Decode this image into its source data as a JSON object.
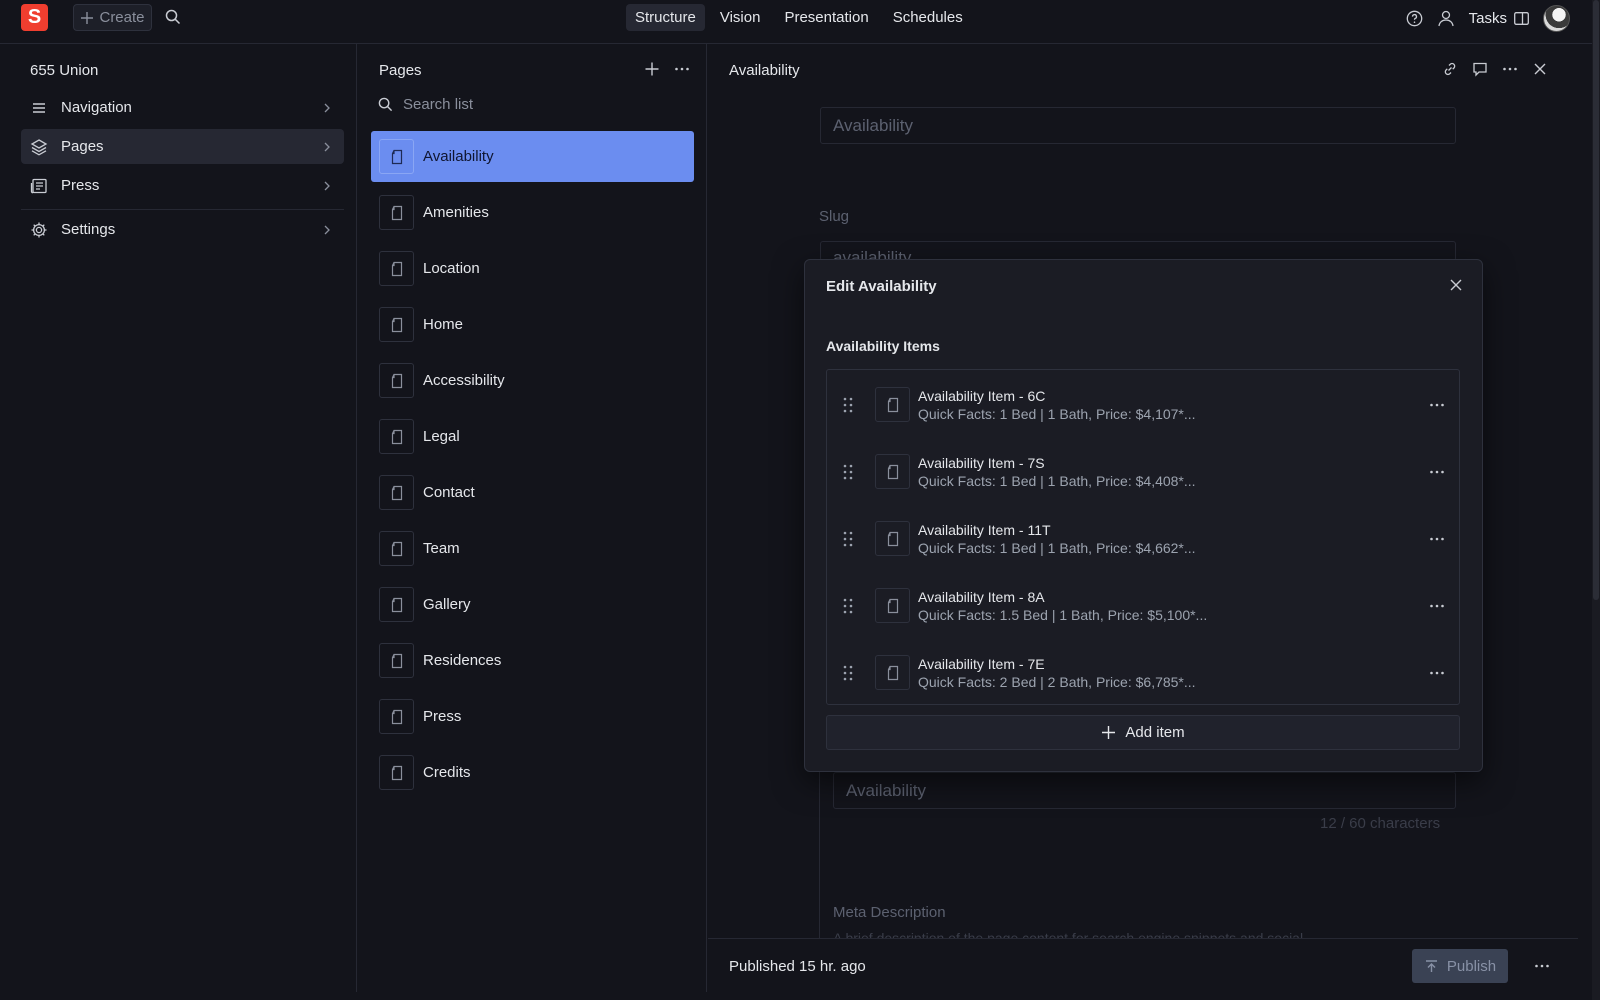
{
  "app": {
    "logo_letter": "S",
    "create_label": "Create",
    "brand_color": "#f03e2f",
    "accent_color": "#6b8df0"
  },
  "topnav": {
    "tabs": [
      {
        "label": "Structure",
        "active": true
      },
      {
        "label": "Vision",
        "active": false
      },
      {
        "label": "Presentation",
        "active": false
      },
      {
        "label": "Schedules",
        "active": false
      }
    ],
    "tasks_label": "Tasks"
  },
  "left": {
    "title": "655 Union",
    "items": [
      {
        "label": "Navigation",
        "icon": "menu-icon"
      },
      {
        "label": "Pages",
        "icon": "layers-icon",
        "active": true
      },
      {
        "label": "Press",
        "icon": "newspaper-icon"
      },
      {
        "label": "Settings",
        "icon": "gear-icon"
      }
    ]
  },
  "pages": {
    "title": "Pages",
    "search_placeholder": "Search list",
    "items": [
      "Availability",
      "Amenities",
      "Location",
      "Home",
      "Accessibility",
      "Legal",
      "Contact",
      "Team",
      "Gallery",
      "Residences",
      "Press",
      "Credits"
    ],
    "selected": "Availability"
  },
  "document": {
    "title": "Availability",
    "title_field_value": "Availability",
    "slug_label": "Slug",
    "slug_value": "availability",
    "seo_title_value": "Availability",
    "char_count": "12 / 60 characters",
    "meta_description_label": "Meta Description",
    "meta_description_placeholder": "A brief description of the page content for search engine snippets and social"
  },
  "modal": {
    "title": "Edit Availability",
    "section_label": "Availability Items",
    "items": [
      {
        "title": "Availability Item - 6C",
        "subtitle": "Quick Facts: 1 Bed | 1 Bath, Price: $4,107*..."
      },
      {
        "title": "Availability Item - 7S",
        "subtitle": "Quick Facts: 1 Bed | 1 Bath, Price: $4,408*..."
      },
      {
        "title": "Availability Item - 11T",
        "subtitle": "Quick Facts: 1 Bed | 1 Bath, Price: $4,662*..."
      },
      {
        "title": "Availability Item - 8A",
        "subtitle": "Quick Facts: 1.5 Bed | 1 Bath, Price: $5,100*..."
      },
      {
        "title": "Availability Item - 7E",
        "subtitle": "Quick Facts: 2 Bed | 2 Bath, Price: $6,785*..."
      }
    ],
    "add_item_label": "Add item"
  },
  "footer": {
    "status": "Published 15 hr. ago",
    "publish_label": "Publish"
  }
}
